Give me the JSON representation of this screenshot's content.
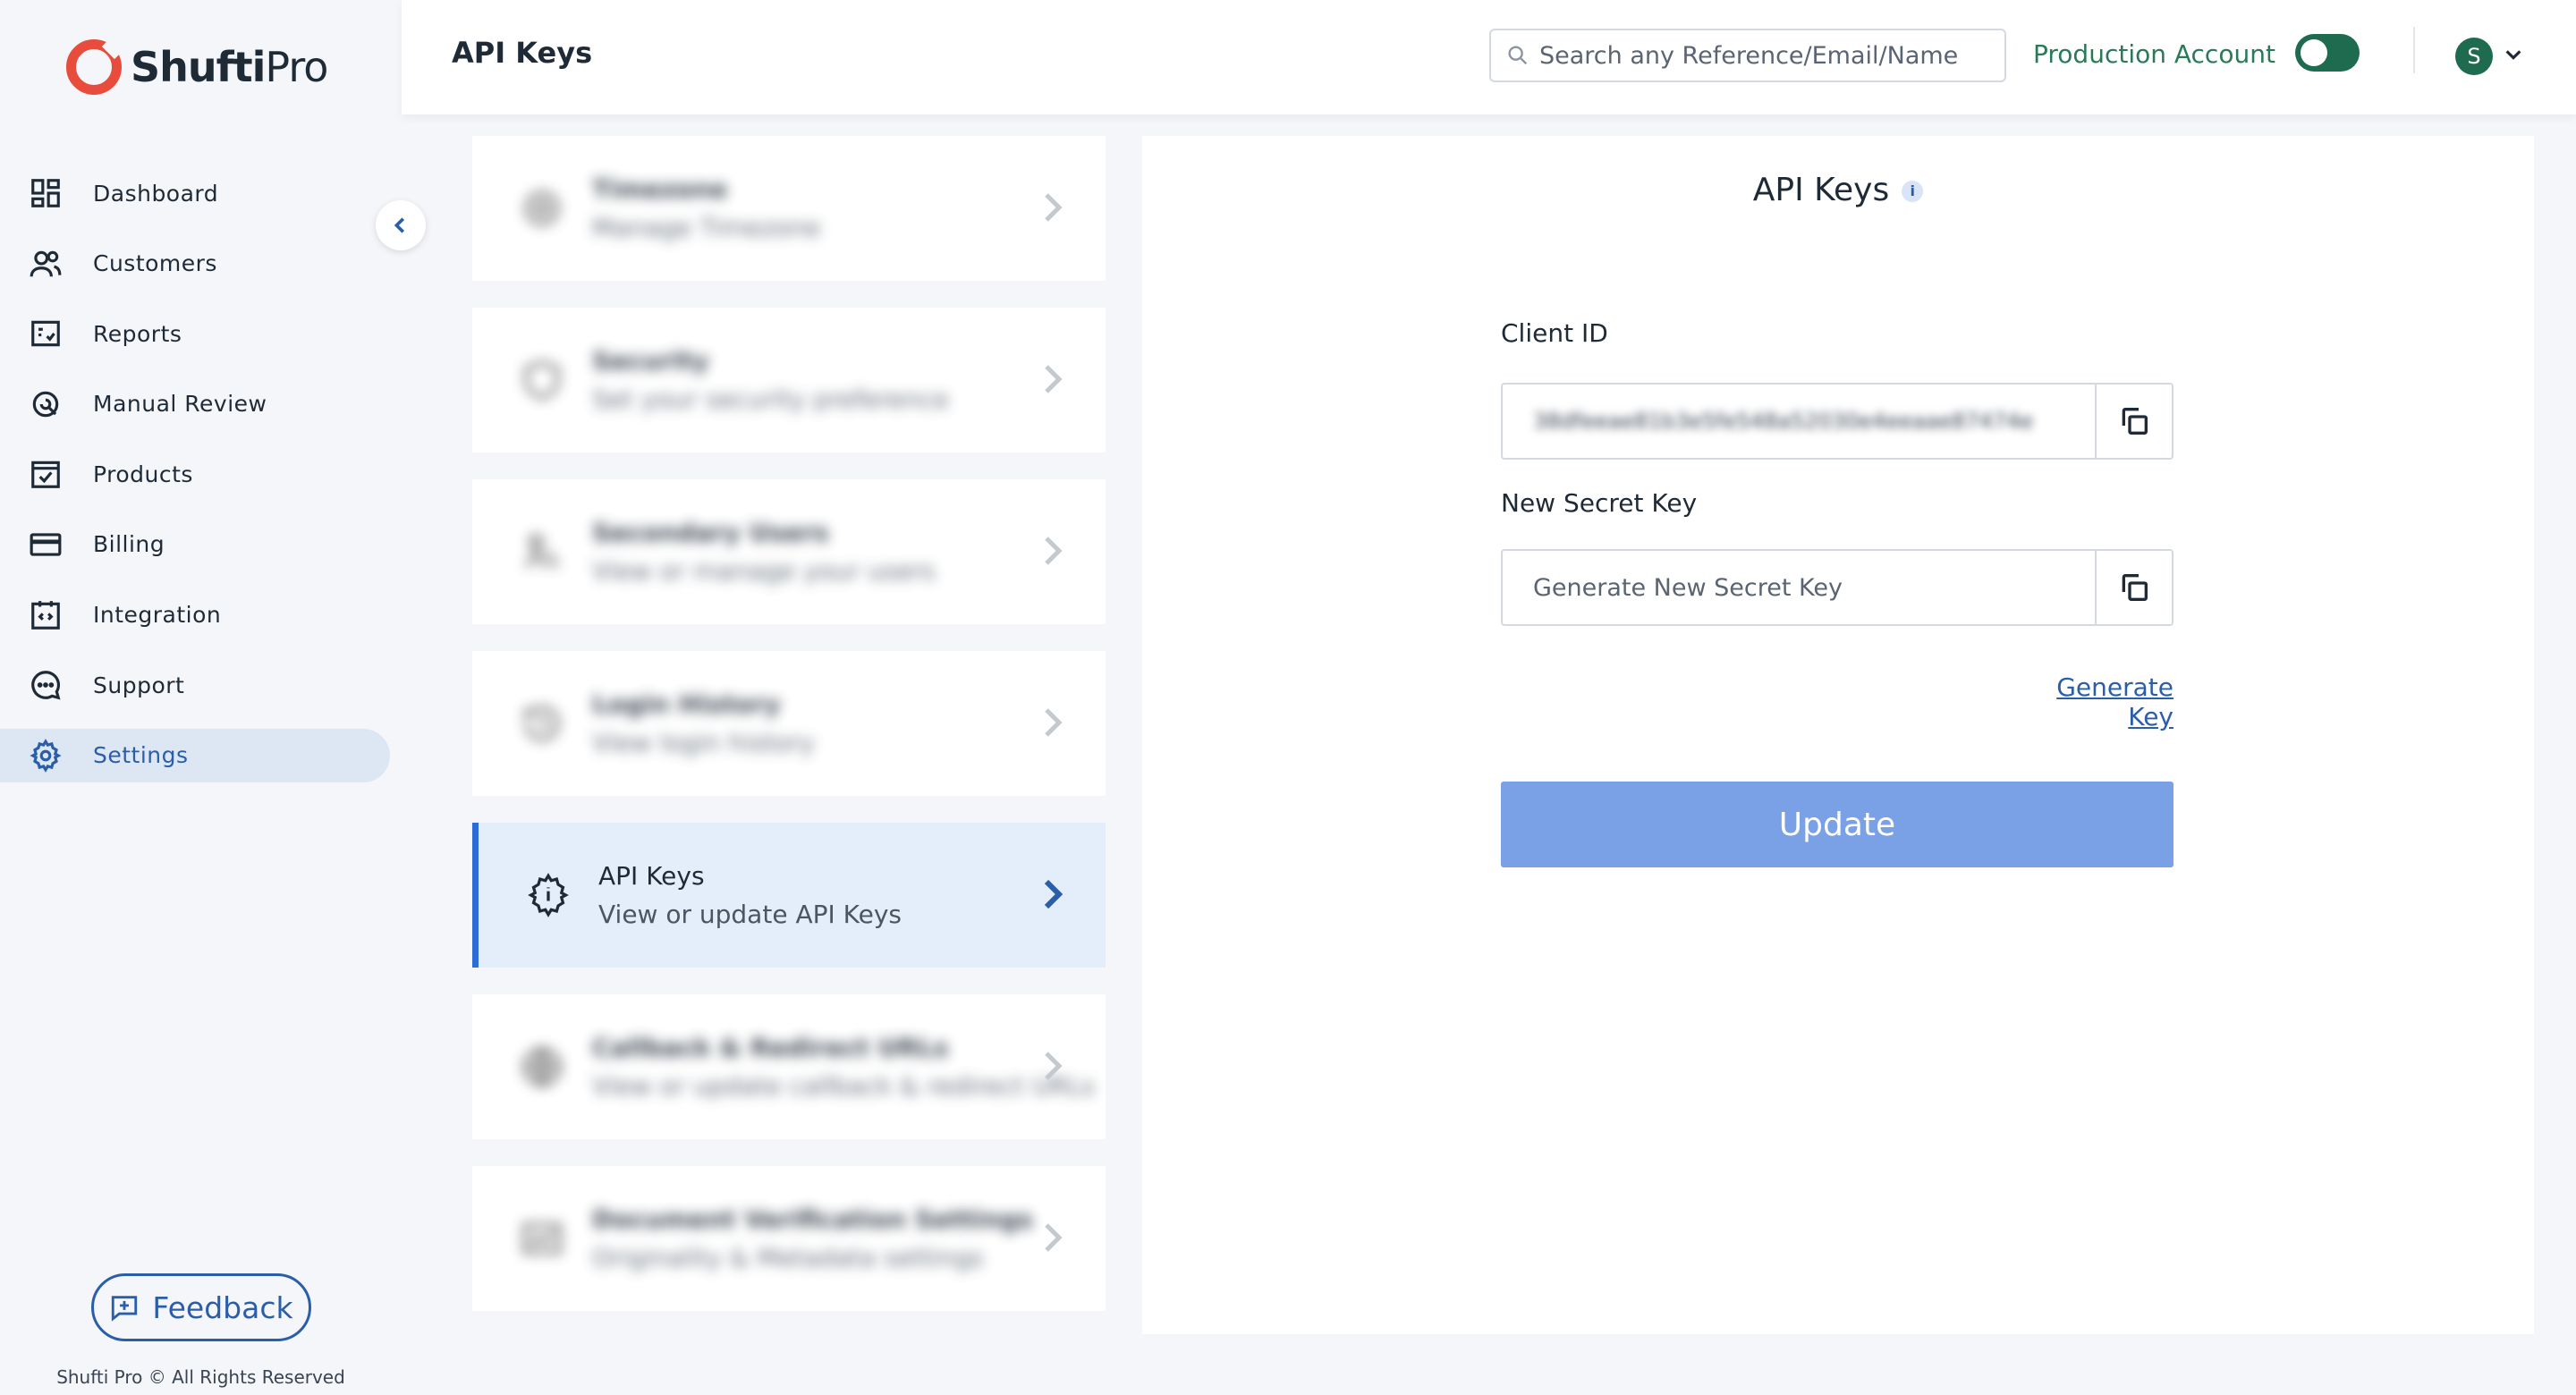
{
  "brand": {
    "name_bold": "Shufti",
    "name_light": "Pro",
    "copyright": "Shufti Pro © All Rights Reserved"
  },
  "sidebar": {
    "items": [
      {
        "label": "Dashboard",
        "icon": "dashboard-icon"
      },
      {
        "label": "Customers",
        "icon": "users-icon"
      },
      {
        "label": "Reports",
        "icon": "report-icon"
      },
      {
        "label": "Manual Review",
        "icon": "review-icon"
      },
      {
        "label": "Products",
        "icon": "products-icon"
      },
      {
        "label": "Billing",
        "icon": "credit-card-icon"
      },
      {
        "label": "Integration",
        "icon": "code-icon"
      },
      {
        "label": "Support",
        "icon": "chat-icon"
      },
      {
        "label": "Settings",
        "icon": "gear-icon",
        "active": true
      }
    ],
    "feedback_label": "Feedback"
  },
  "header": {
    "title": "API Keys",
    "search_placeholder": "Search any Reference/Email/Name",
    "account_label": "Production Account",
    "avatar_initial": "S"
  },
  "settings": {
    "cards": [
      {
        "title": "Timezone",
        "subtitle": "Manage Timezone"
      },
      {
        "title": "Security",
        "subtitle": "Set your security preference"
      },
      {
        "title": "Secondary Users",
        "subtitle": "View or manage your users"
      },
      {
        "title": "Login History",
        "subtitle": "View login history"
      },
      {
        "title": "API Keys",
        "subtitle": "View or update API Keys"
      },
      {
        "title": "Callback & Redirect URLs",
        "subtitle": "View or update callback & redirect URLs"
      },
      {
        "title": "Document Verification Settings",
        "subtitle": "Originality & Metadata settings"
      }
    ]
  },
  "panel": {
    "title": "API Keys",
    "info": "i",
    "client_id_label": "Client ID",
    "client_id_value": "38dfeeae81b3e5fe548a52030e4eeaae87474e",
    "secret_label": "New Secret Key",
    "secret_placeholder": "Generate New Secret Key",
    "generate_link": "Generate Key",
    "update_label": "Update"
  },
  "colors": {
    "accent": "#2b5ea8",
    "brand_red": "#e74c3c",
    "toggle": "#1f6b4f",
    "update_btn": "#7aa0e6"
  }
}
